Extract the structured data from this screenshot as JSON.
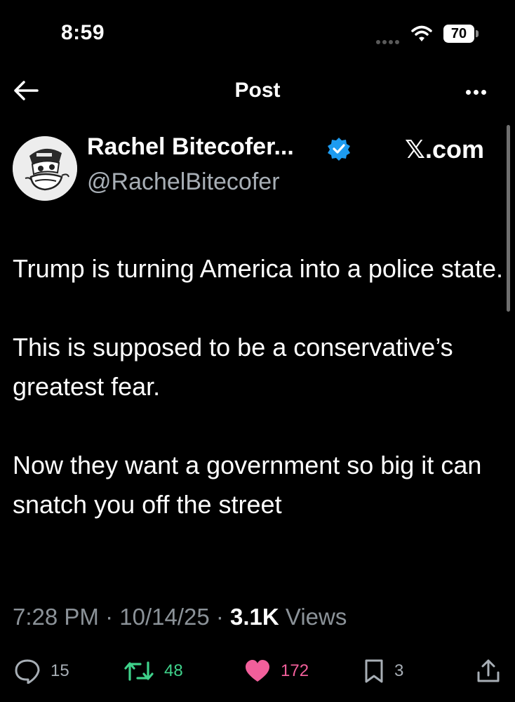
{
  "status_bar": {
    "time": "8:59",
    "battery": "70",
    "icons": [
      "signal-dots-icon",
      "wifi-icon",
      "battery-icon"
    ]
  },
  "nav": {
    "title": "Post",
    "back_icon": "arrow-left-icon",
    "more_icon": "more-horizontal-icon"
  },
  "post": {
    "author": {
      "display_name": "Rachel Bitecofer...",
      "handle": "@RachelBitecofer",
      "verified": true,
      "verified_color": "#1d9bf0"
    },
    "source": "𝕏.com",
    "paragraphs": [
      "Trump is turning America into a police state.",
      "This is supposed to be a conservative’s greatest fear.",
      "Now they want a government so big it can snatch you off the street"
    ],
    "meta": {
      "time": "7:28 PM",
      "separator": " · ",
      "date": "10/14/25",
      "views_count": "3.1K",
      "views_label": " Views"
    }
  },
  "actions": {
    "replies": "15",
    "reposts": "48",
    "likes": "172",
    "bookmarks": "3",
    "colors": {
      "reply": "#a7aeb5",
      "repost": "#3fd28b",
      "like": "#f25f9b",
      "bookmark": "#a7aeb5"
    }
  }
}
